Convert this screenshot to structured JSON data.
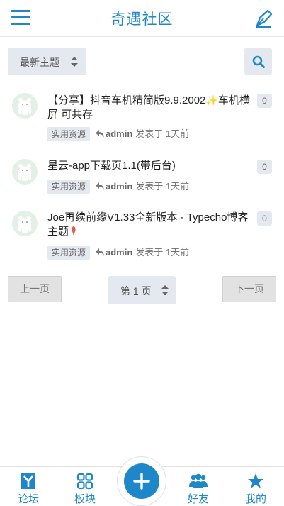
{
  "header": {
    "title": "奇遇社区",
    "menu_icon": "hamburger-menu-icon",
    "compose_icon": "pen-icon",
    "accent": "#1e87c9"
  },
  "toolbar": {
    "sort_value": "最新主题",
    "search_icon": "search-icon"
  },
  "topics": [
    {
      "title": "【分享】抖音车机精简版9.9.2002",
      "title_tail": "车机横屏 可共存",
      "reply_count": "0",
      "tag": "实用资源",
      "author": "admin",
      "posted": "发表于 1天前"
    },
    {
      "title": "星云-app下载页1.1(带后台)",
      "reply_count": "0",
      "tag": "实用资源",
      "author": "admin",
      "posted": "发表于 1天前"
    },
    {
      "title": "Joe再续前缘V1.33全新版本 - Typecho博客主题",
      "reply_count": "0",
      "tag": "实用资源",
      "author": "admin",
      "posted": "发表于 1天前"
    }
  ],
  "pagination": {
    "prev": "上一页",
    "current": "第 1 页",
    "next": "下一页"
  },
  "tabbar": {
    "forum": "论坛",
    "sections": "板块",
    "friends": "好友",
    "me": "我的",
    "add_icon": "plus-icon"
  }
}
